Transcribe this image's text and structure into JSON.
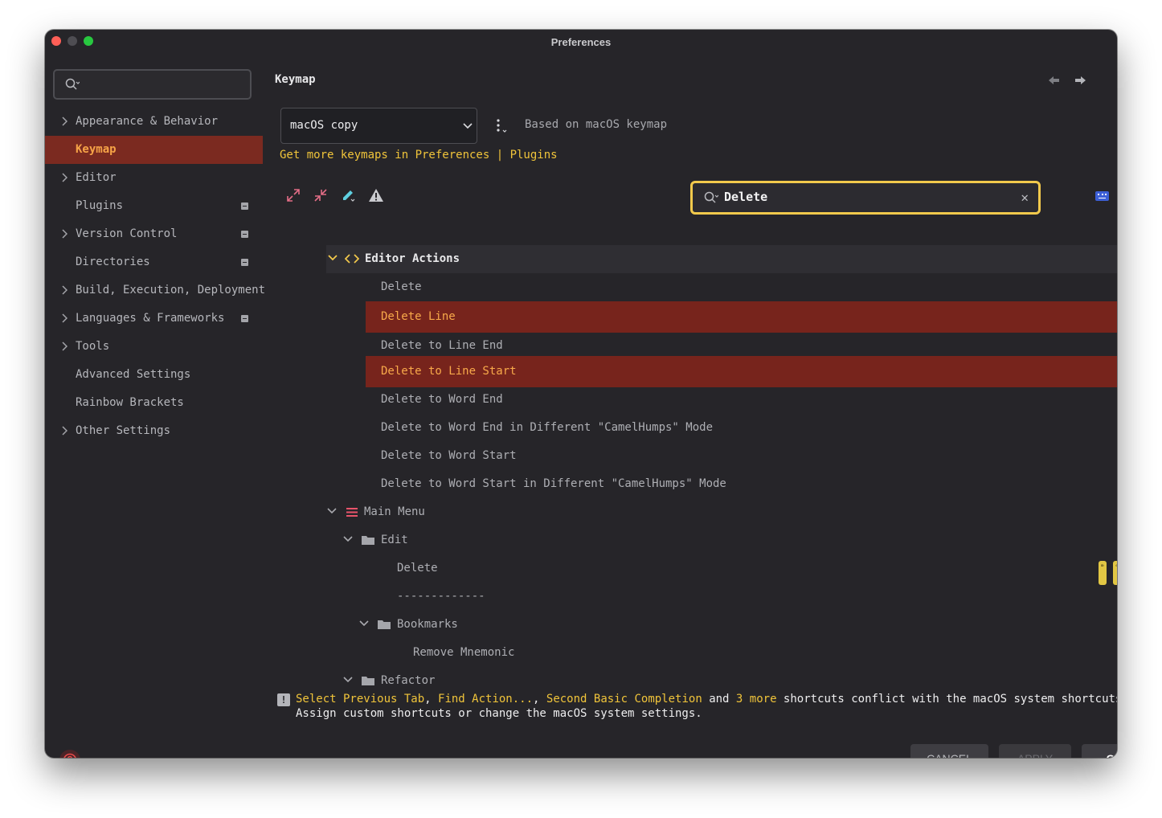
{
  "window": {
    "title": "Preferences"
  },
  "sidebar": {
    "search_placeholder": "",
    "items": [
      {
        "label": "Appearance & Behavior",
        "chevron": true,
        "badge": false
      },
      {
        "label": "Keymap",
        "chevron": false,
        "badge": false,
        "active": true
      },
      {
        "label": "Editor",
        "chevron": true,
        "badge": false
      },
      {
        "label": "Plugins",
        "chevron": false,
        "badge": true
      },
      {
        "label": "Version Control",
        "chevron": true,
        "badge": true
      },
      {
        "label": "Directories",
        "chevron": false,
        "badge": true
      },
      {
        "label": "Build, Execution, Deployment",
        "chevron": true,
        "badge": false
      },
      {
        "label": "Languages & Frameworks",
        "chevron": true,
        "badge": true
      },
      {
        "label": "Tools",
        "chevron": true,
        "badge": false
      },
      {
        "label": "Advanced Settings",
        "chevron": false,
        "badge": false
      },
      {
        "label": "Rainbow Brackets",
        "chevron": false,
        "badge": false
      },
      {
        "label": "Other Settings",
        "chevron": true,
        "badge": false
      }
    ]
  },
  "main": {
    "title": "Keymap",
    "keymap_select": "macOS copy",
    "based_on": "Based on macOS keymap",
    "get_more": "Get more keymaps in Preferences | Plugins",
    "filter_value": "Delete",
    "tree": {
      "editor_actions": "Editor Actions",
      "editor_items": [
        "Delete",
        "Delete Line",
        "Delete to Line End",
        "Delete to Line Start",
        "Delete to Word End",
        "Delete to Word End in Different \"CamelHumps\" Mode",
        "Delete to Word Start",
        "Delete to Word Start in Different \"CamelHumps\" Mode"
      ],
      "main_menu": "Main Menu",
      "edit": "Edit",
      "edit_delete": "Delete",
      "separator": "-------------",
      "bookmarks": "Bookmarks",
      "remove_mnemonic": "Remove Mnemonic",
      "refactor": "Refactor"
    },
    "shortcut_keys": {
      "delete": "⌦",
      "delete_to_line_start": "⌘⌫",
      "delete_to_word_end": "⌥⌦",
      "delete_to_word_start": "⌥⌫",
      "edit_delete": [
        "⌦",
        "⌫",
        "⌘⌫"
      ]
    },
    "conflict": {
      "link1": "Select Previous Tab",
      "sep1": ", ",
      "link2": "Find Action...",
      "sep2": ", ",
      "link3": "Second Basic Completion",
      "and": " and ",
      "link4": "3 more",
      "rest": " shortcuts conflict with the macOS system shortcuts.",
      "line2": "Assign custom shortcuts or change the macOS system settings."
    }
  },
  "buttons": {
    "cancel": "CANCEL",
    "apply": "APPLY",
    "ok": "OK"
  },
  "colors": {
    "selection": "#77241c",
    "selection_text": "#f8a94a",
    "accent_yellow": "#f0c43a",
    "focus_ring": "#f2c94c",
    "background": "#262529"
  }
}
